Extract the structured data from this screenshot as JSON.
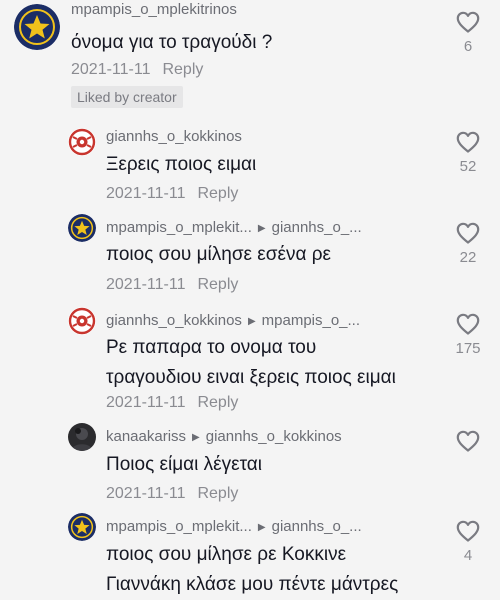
{
  "colors": {
    "star_badge_bg": "#1b2d66",
    "star_badge_ring": "#f1c21b",
    "red_logo": "#c8352e"
  },
  "comments": [
    {
      "avatar_icon": "star-badge-icon",
      "username": "mpampis_o_mplekitrinos",
      "reply_to": "",
      "lines": [
        "όνομα για το τραγούδι ?"
      ],
      "date": "2021-11-11",
      "reply_label": "Reply",
      "badge": "Liked by creator",
      "likes": "6"
    },
    {
      "avatar_icon": "red-emblem-icon",
      "username": "giannhs_o_kokkinos",
      "reply_to": "",
      "lines": [
        "Ξερεις ποιος ειμαι"
      ],
      "date": "2021-11-11",
      "reply_label": "Reply",
      "likes": "52"
    },
    {
      "avatar_icon": "star-badge-icon",
      "username": "mpampis_o_mplekit...",
      "reply_to": "giannhs_o_...",
      "lines": [
        "ποιος σου μίλησε εσένα ρε"
      ],
      "date": "2021-11-11",
      "reply_label": "Reply",
      "likes": "22"
    },
    {
      "avatar_icon": "red-emblem-icon",
      "username": "giannhs_o_kokkinos",
      "reply_to": "mpampis_o_...",
      "lines": [
        "Ρε παπαρα το ονομα του",
        "τραγουδιου ειναι ξερεις ποιος ειμαι"
      ],
      "date": "2021-11-11",
      "reply_label": "Reply",
      "likes": "175"
    },
    {
      "avatar_icon": "dark-photo-avatar",
      "username": "kanaakariss",
      "reply_to": "giannhs_o_kokkinos",
      "lines": [
        "Ποιος είμαι λέγεται"
      ],
      "date": "2021-11-11",
      "reply_label": "Reply",
      "likes": ""
    },
    {
      "avatar_icon": "star-badge-icon",
      "username": "mpampis_o_mplekit...",
      "reply_to": "giannhs_o_...",
      "lines": [
        "ποιος σου μίλησε ρε Κοκκινε",
        "Γιαννάκη κλάσε μου πέντε μάντρες"
      ],
      "date": "",
      "reply_label": "",
      "likes": "4"
    }
  ]
}
